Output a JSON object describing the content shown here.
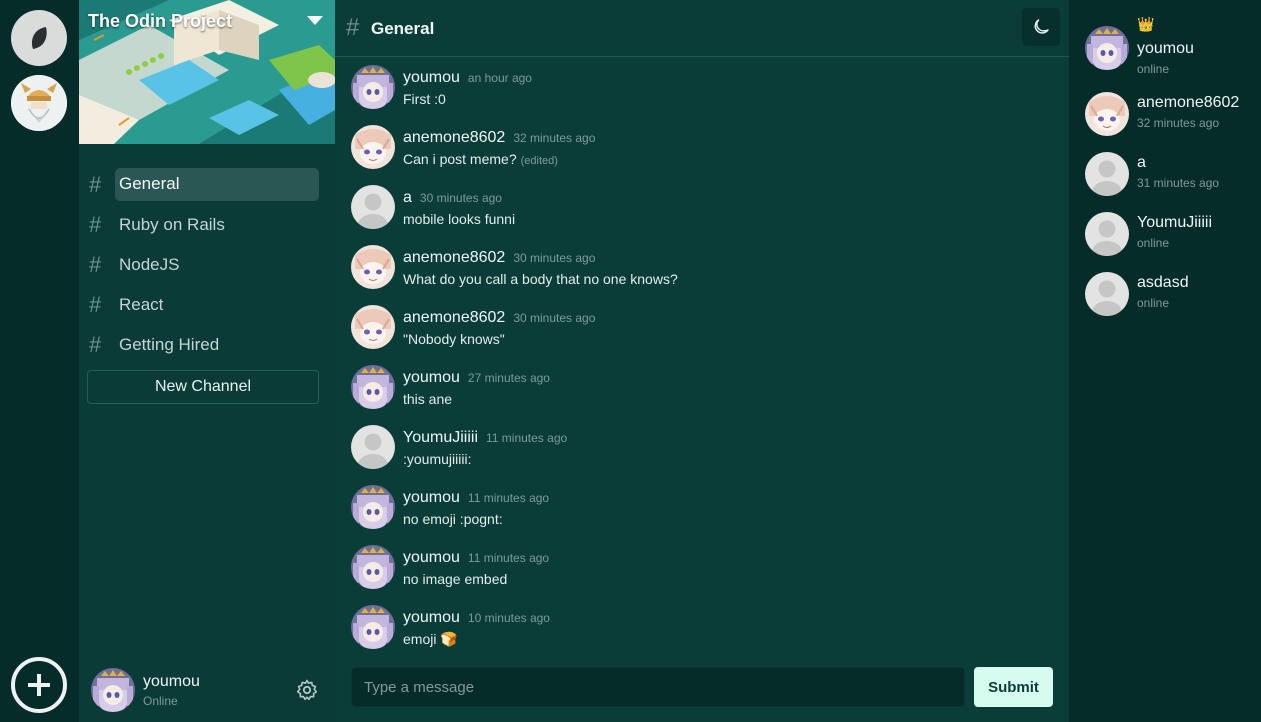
{
  "server": {
    "name": "The Odin Project",
    "add_icon": "plus-circle-icon",
    "home_icon": "leaf-logo-icon"
  },
  "channels": [
    {
      "label": "General",
      "active": true
    },
    {
      "label": "Ruby on Rails",
      "active": false
    },
    {
      "label": "NodeJS",
      "active": false
    },
    {
      "label": "React",
      "active": false
    },
    {
      "label": "Getting Hired",
      "active": false
    }
  ],
  "new_channel_label": "New Channel",
  "current_user": {
    "name": "youmou",
    "status": "Online"
  },
  "chat": {
    "channel_title": "General",
    "messages": [
      {
        "author": "youmou",
        "time": "an hour ago",
        "text": "First :0",
        "edited": ""
      },
      {
        "author": "anemone8602",
        "time": "32 minutes ago",
        "text": "Can i post meme?",
        "edited": "(edited)"
      },
      {
        "author": "a",
        "time": "30 minutes ago",
        "text": "mobile looks funni",
        "edited": ""
      },
      {
        "author": "anemone8602",
        "time": "30 minutes ago",
        "text": "What do you call a body that no one knows?",
        "edited": ""
      },
      {
        "author": "anemone8602",
        "time": "30 minutes ago",
        "text": "\"Nobody knows\"",
        "edited": ""
      },
      {
        "author": "youmou",
        "time": "27 minutes ago",
        "text": "this ane",
        "edited": ""
      },
      {
        "author": "YoumuJiiiii",
        "time": "11 minutes ago",
        "text": ":youmujiiiii:",
        "edited": ""
      },
      {
        "author": "youmou",
        "time": "11 minutes ago",
        "text": "no emoji :pognt:",
        "edited": ""
      },
      {
        "author": "youmou",
        "time": "11 minutes ago",
        "text": "no image embed",
        "edited": ""
      },
      {
        "author": "youmou",
        "time": "10 minutes ago",
        "text": "emoji 🍞",
        "edited": ""
      }
    ],
    "composer_placeholder": "Type a message",
    "submit_label": "Submit"
  },
  "members": [
    {
      "name": "youmou",
      "status": "online",
      "owner": true
    },
    {
      "name": "anemone8602",
      "status": "32 minutes ago",
      "owner": false
    },
    {
      "name": "a",
      "status": "31 minutes ago",
      "owner": false
    },
    {
      "name": "YoumuJiiiii",
      "status": "online",
      "owner": false
    },
    {
      "name": "asdasd",
      "status": "online",
      "owner": false
    }
  ],
  "colors": {
    "rail_bg": "#062c29",
    "sidebar_bg": "#0a3b36",
    "chat_bg": "#0b3d38",
    "active_channel_bg": "#2a5753",
    "submit_bg": "#d5fcef"
  }
}
